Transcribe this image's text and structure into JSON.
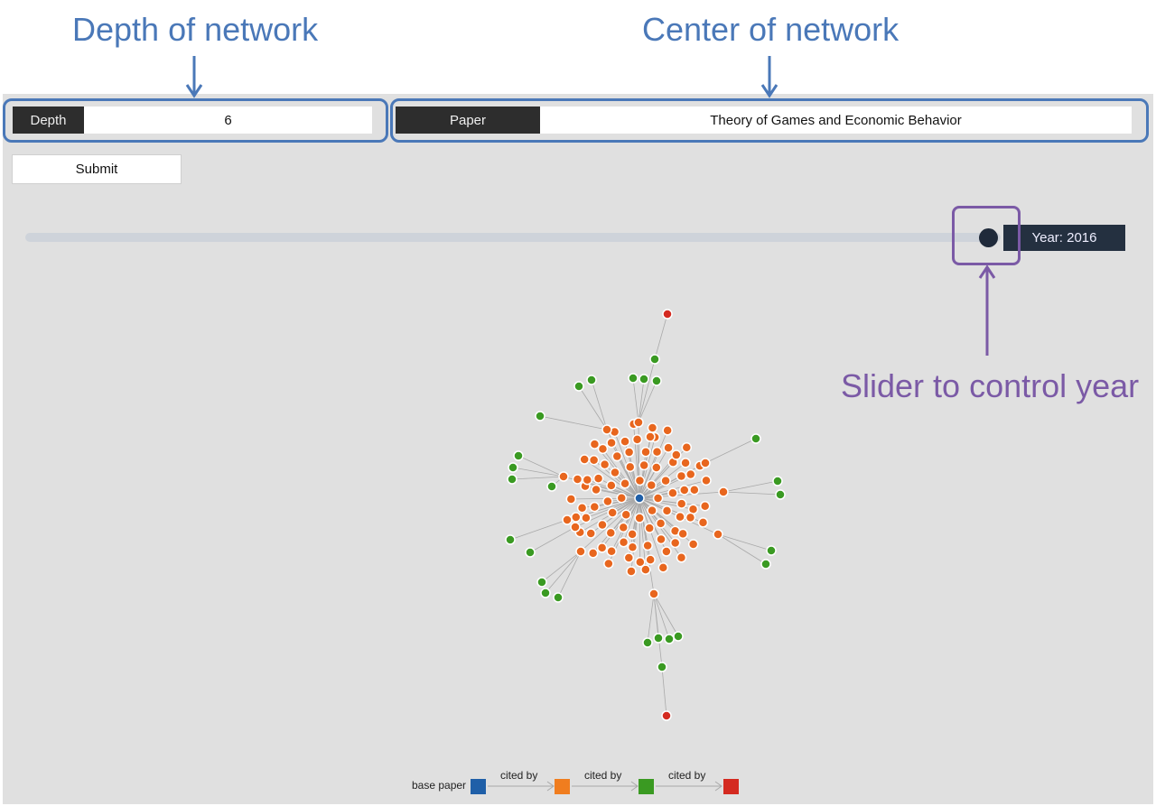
{
  "annotations": {
    "depth_title": "Depth of network",
    "center_title": "Center of network",
    "slider_note": "Slider to control year"
  },
  "controls": {
    "depth_label": "Depth",
    "depth_value": "6",
    "paper_label": "Paper",
    "paper_value": "Theory of Games and Economic Behavior",
    "submit_label": "Submit"
  },
  "slider": {
    "year_label": "Year: 2016"
  },
  "legend": {
    "items": [
      {
        "label": "base paper",
        "color": "#1f5fa8"
      },
      {
        "label": "cited by",
        "color": "#f07d1f"
      },
      {
        "label": "cited by",
        "color": "#3a9a22"
      },
      {
        "label": "cited by",
        "color": "#d42a20"
      }
    ]
  },
  "colors": {
    "annotation_blue": "#4a78b8",
    "annotation_purple": "#7b5aa6",
    "base_node": "#1f5fa8",
    "level1_node": "#e8661e",
    "level2_node": "#3a9a22",
    "level3_node": "#d42a20",
    "edge": "#a9a9a9"
  },
  "network": {
    "base_paper": "Theory of Games and Economic Behavior",
    "levels": [
      "base paper",
      "cited by",
      "cited by",
      "cited by"
    ]
  }
}
